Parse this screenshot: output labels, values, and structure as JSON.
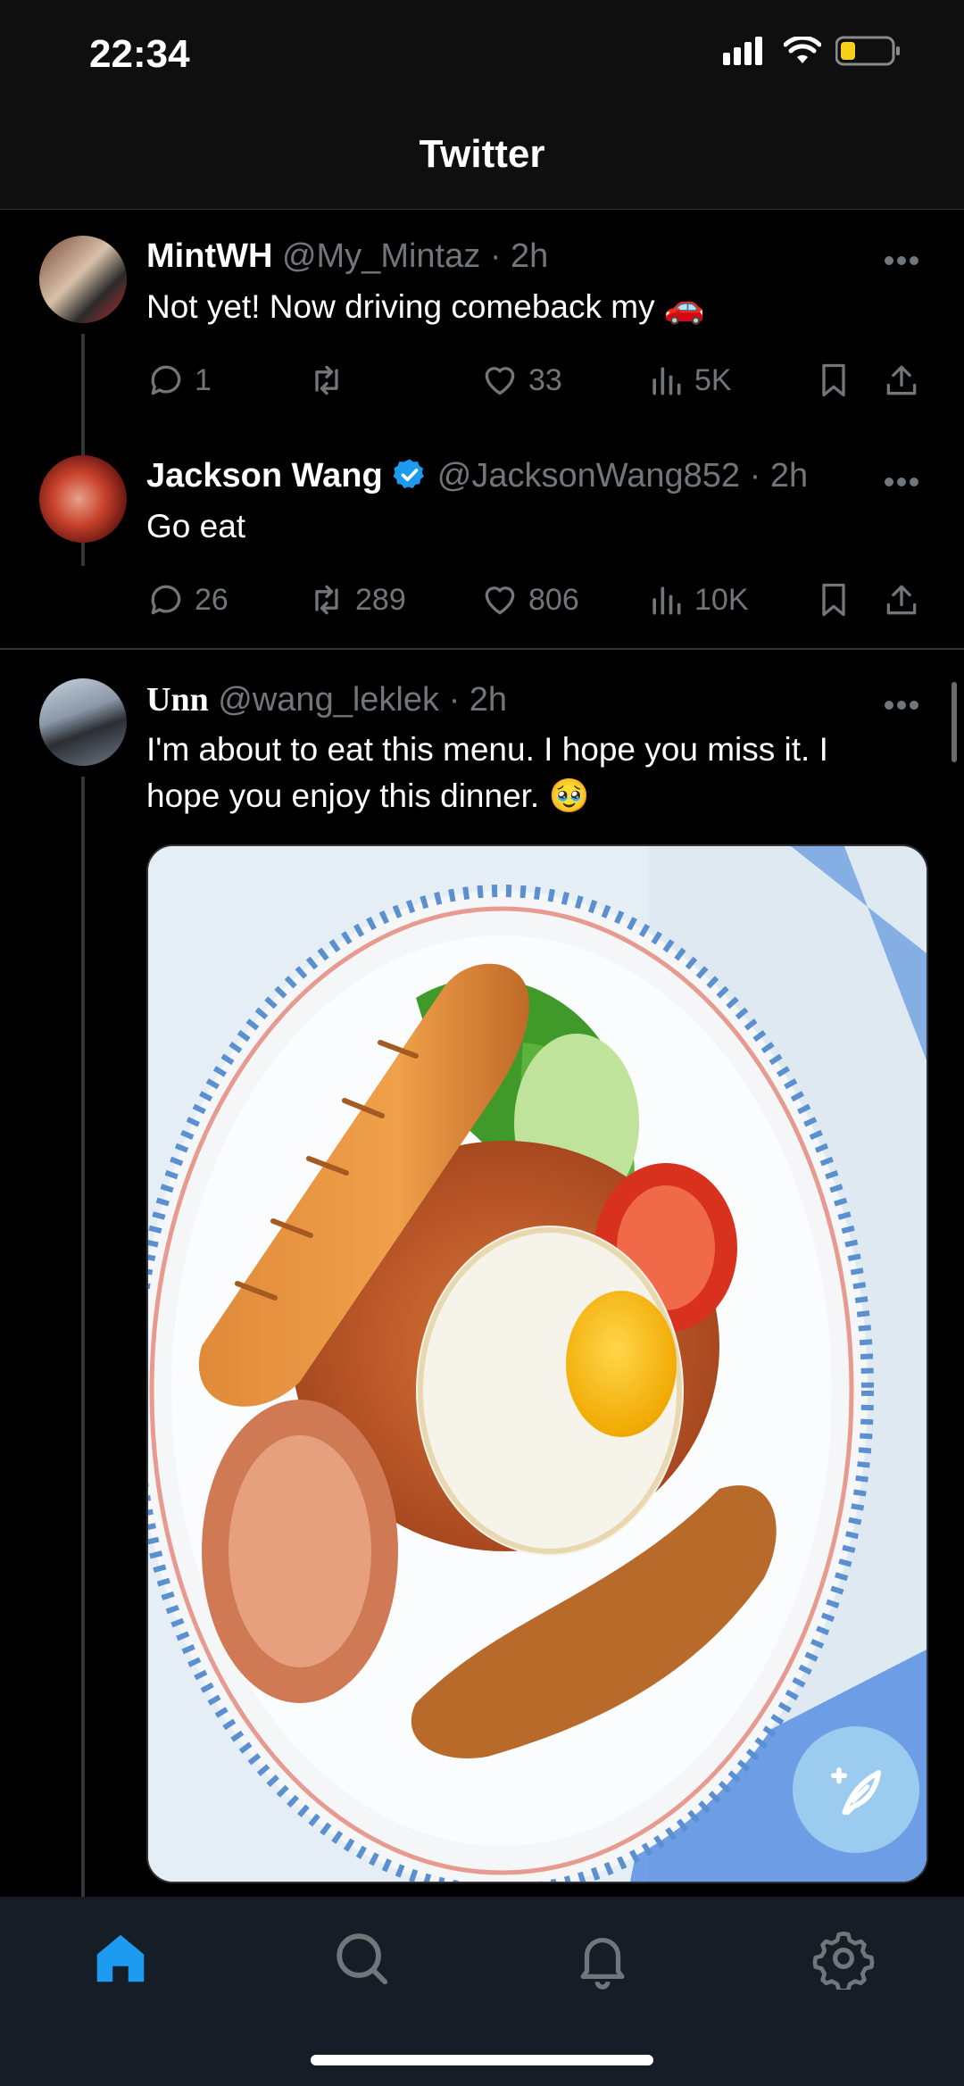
{
  "status": {
    "time": "22:34"
  },
  "header": {
    "title": "Twitter"
  },
  "tweets": [
    {
      "name": "MintWH",
      "handle": "@My_Mintaz",
      "time": "· 2h",
      "text": "Not yet! Now driving comeback my",
      "emoji": "🚗",
      "replies": "1",
      "retweets": "",
      "likes": "33",
      "views": "5K"
    },
    {
      "name": "Jackson Wang",
      "handle": "@JacksonWang852",
      "time": "· 2h",
      "text": "Go eat",
      "replies": "26",
      "retweets": "289",
      "likes": "806",
      "views": "10K"
    },
    {
      "name": "Unn",
      "handle": "@wang_leklek",
      "time": "· 2h",
      "text": "I'm about to eat this menu. I hope you miss it. I hope you enjoy this dinner.",
      "emoji": "🥹"
    }
  ],
  "colors": {
    "accent": "#1d9bf0",
    "fab": "#9ccbf0",
    "tabbar": "#161d26",
    "muted": "#71767b"
  },
  "tabs": [
    {
      "icon": "home-icon",
      "active": true
    },
    {
      "icon": "search-icon",
      "active": false
    },
    {
      "icon": "bell-icon",
      "active": false
    },
    {
      "icon": "gear-icon",
      "active": false
    }
  ]
}
